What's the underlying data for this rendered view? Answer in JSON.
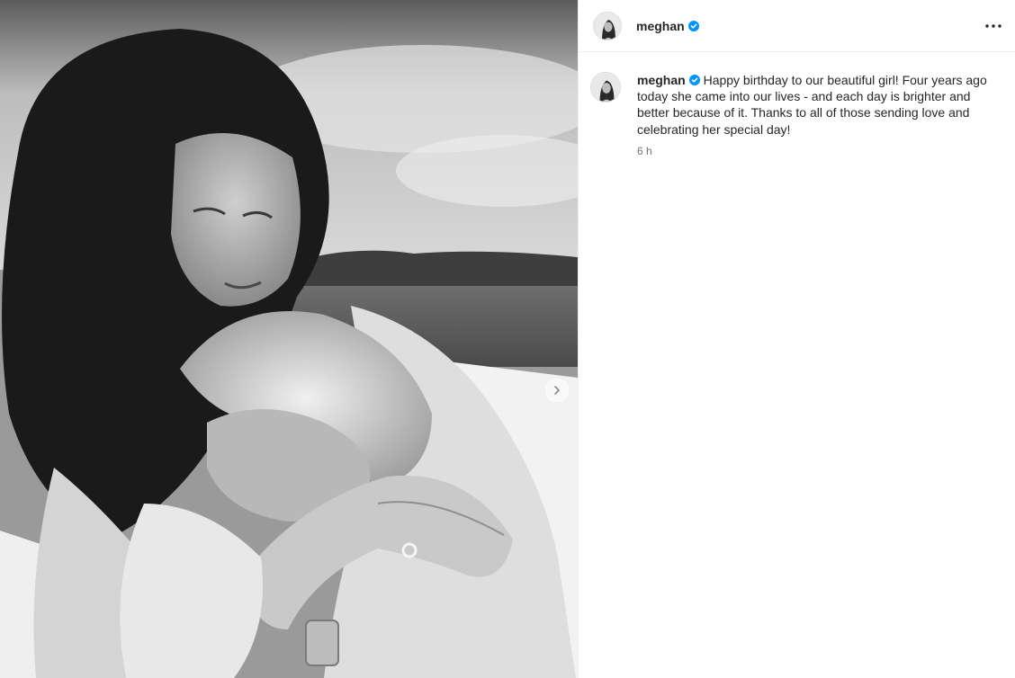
{
  "post": {
    "author": {
      "username": "meghan",
      "verified": true,
      "avatar_icon": "profile-photo"
    },
    "caption": "Happy birthday to our beautiful girl! Four years ago today she came into our lives - and each day is brighter and better because of it. Thanks to all of those sending love and celebrating her special day!",
    "timestamp": "6 h",
    "media_type": "black-and-white photo",
    "has_next_slide": true
  },
  "icons": {
    "verified": "verified-badge-icon",
    "more": "more-options-icon",
    "next": "chevron-right-icon"
  },
  "colors": {
    "verified_blue": "#0095f6",
    "text": "#262626",
    "secondary_text": "#737373",
    "divider": "#efefef"
  }
}
